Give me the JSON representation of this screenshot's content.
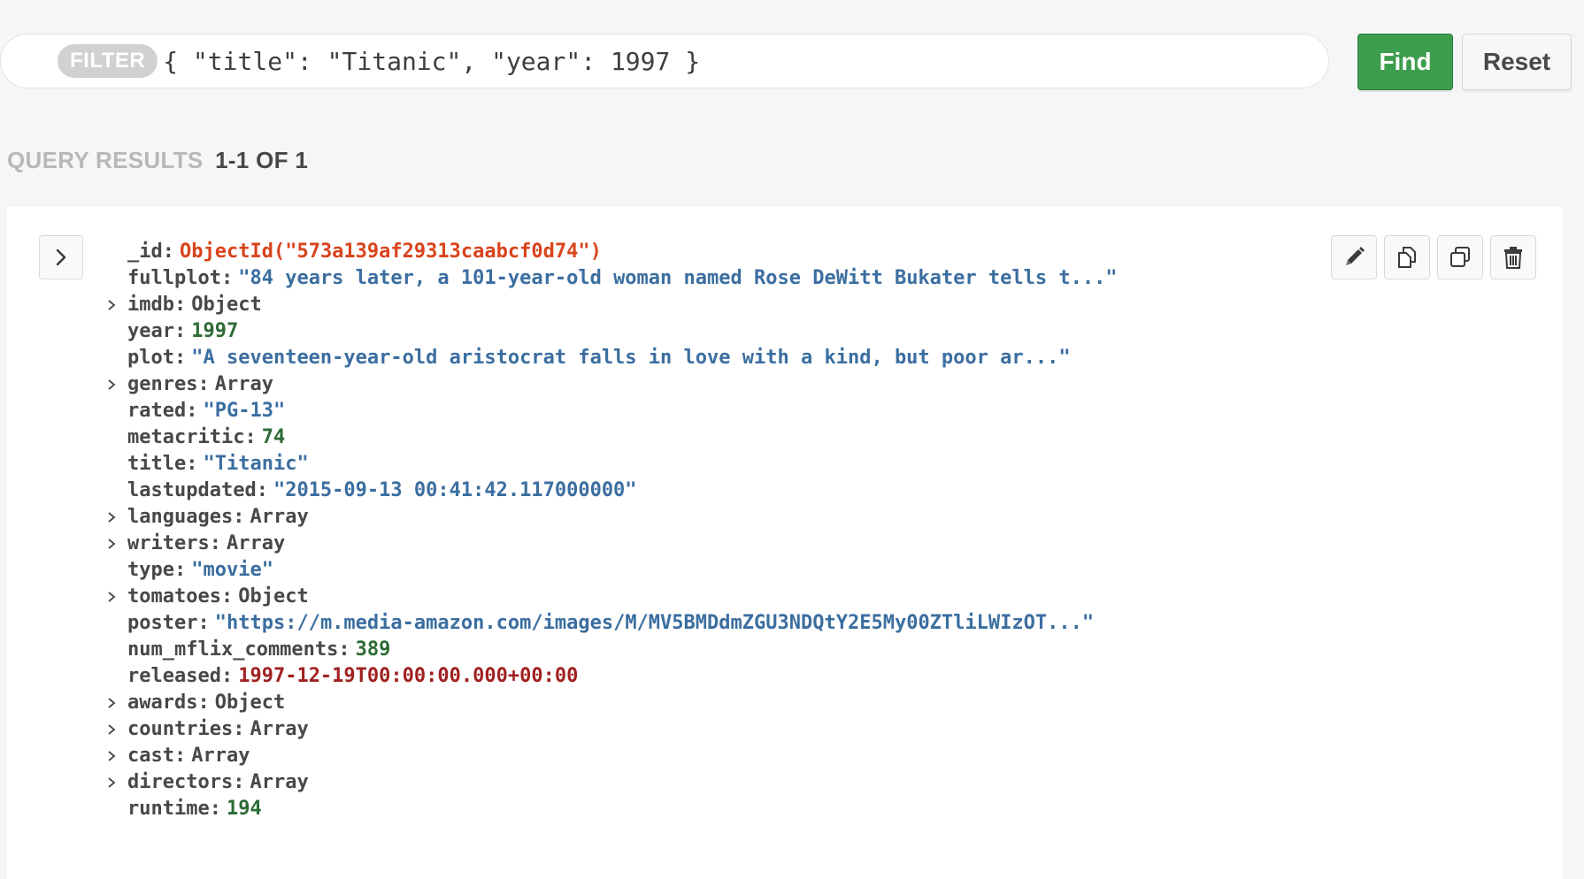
{
  "filter": {
    "badge": "FILTER",
    "query": "{ \"title\": \"Titanic\", \"year\": 1997 }"
  },
  "buttons": {
    "find": "Find",
    "reset": "Reset"
  },
  "results": {
    "label": "QUERY RESULTS",
    "count": "1-1 OF 1"
  },
  "document": {
    "fields": [
      {
        "key": "_id",
        "value": "ObjectId(\"573a139af29313caabcf0d74\")",
        "kind": "oid",
        "expandable": false
      },
      {
        "key": "fullplot",
        "value": "\"84 years later, a 101-year-old woman named Rose DeWitt Bukater tells t...\"",
        "kind": "str",
        "expandable": false
      },
      {
        "key": "imdb",
        "value": "Object",
        "kind": "type",
        "expandable": true
      },
      {
        "key": "year",
        "value": "1997",
        "kind": "num",
        "expandable": false
      },
      {
        "key": "plot",
        "value": "\"A seventeen-year-old aristocrat falls in love with a kind, but poor ar...\"",
        "kind": "str",
        "expandable": false
      },
      {
        "key": "genres",
        "value": "Array",
        "kind": "type",
        "expandable": true
      },
      {
        "key": "rated",
        "value": "\"PG-13\"",
        "kind": "str",
        "expandable": false
      },
      {
        "key": "metacritic",
        "value": "74",
        "kind": "num",
        "expandable": false
      },
      {
        "key": "title",
        "value": "\"Titanic\"",
        "kind": "str",
        "expandable": false
      },
      {
        "key": "lastupdated",
        "value": "\"2015-09-13 00:41:42.117000000\"",
        "kind": "str",
        "expandable": false
      },
      {
        "key": "languages",
        "value": "Array",
        "kind": "type",
        "expandable": true
      },
      {
        "key": "writers",
        "value": "Array",
        "kind": "type",
        "expandable": true
      },
      {
        "key": "type",
        "value": "\"movie\"",
        "kind": "str",
        "expandable": false
      },
      {
        "key": "tomatoes",
        "value": "Object",
        "kind": "type",
        "expandable": true
      },
      {
        "key": "poster",
        "value": "\"https://m.media-amazon.com/images/M/MV5BMDdmZGU3NDQtY2E5My00ZTliLWIzOT...\"",
        "kind": "str",
        "expandable": false
      },
      {
        "key": "num_mflix_comments",
        "value": "389",
        "kind": "num",
        "expandable": false
      },
      {
        "key": "released",
        "value": "1997-12-19T00:00:00.000+00:00",
        "kind": "date",
        "expandable": false
      },
      {
        "key": "awards",
        "value": "Object",
        "kind": "type",
        "expandable": true
      },
      {
        "key": "countries",
        "value": "Array",
        "kind": "type",
        "expandable": true
      },
      {
        "key": "cast",
        "value": "Array",
        "kind": "type",
        "expandable": true
      },
      {
        "key": "directors",
        "value": "Array",
        "kind": "type",
        "expandable": true
      },
      {
        "key": "runtime",
        "value": "194",
        "kind": "num",
        "expandable": false
      }
    ]
  },
  "icons": {
    "expand": "chevron-right-icon",
    "edit": "pencil-icon",
    "copy": "copy-document-icon",
    "clone": "clone-document-icon",
    "delete": "trash-icon",
    "field_expand": "caret-right-icon"
  },
  "colors": {
    "find_button": "#3c9d4c",
    "oid": "#d9431b",
    "string": "#3b6ea0",
    "number": "#2c6b35",
    "date": "#a02020"
  }
}
